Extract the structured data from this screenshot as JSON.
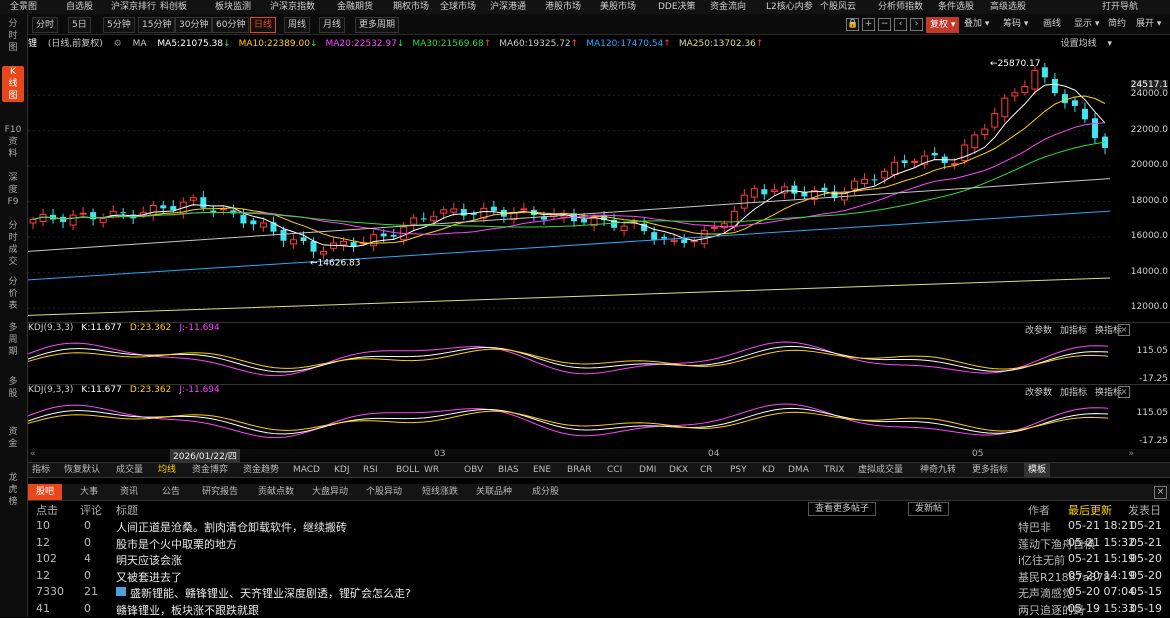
{
  "menubar": [
    "全景图",
    "自选股",
    "沪深京排行",
    "科创板",
    "板块监测",
    "沪深京指数",
    "金融期货",
    "期权市场",
    "全球市场",
    "沪深港通",
    "港股市场",
    "美股市场",
    "DDE决策",
    "资金流向",
    "L2核心内参",
    "个股风云",
    "分析师指数",
    "条件选股",
    "高级选股",
    "打开导航"
  ],
  "leftnav": [
    {
      "label": "分\n时\n图",
      "active": false
    },
    {
      "label": "K\n线\n图",
      "active": true
    },
    {
      "label": "F10\n资\n料",
      "active": false
    },
    {
      "label": "深\n度\nF9",
      "active": false
    },
    {
      "label": "分\n时\n成\n交",
      "active": false
    },
    {
      "label": "分\n价\n表",
      "active": false
    },
    {
      "label": "多\n周\n期",
      "active": false
    },
    {
      "label": "多\n股",
      "active": false
    },
    {
      "label": "资\n金",
      "active": false
    },
    {
      "label": "龙\n虎\n榜",
      "active": false
    }
  ],
  "toolbar": {
    "periods": [
      "分时",
      "5日",
      "5分钟",
      "15分钟",
      "30分钟",
      "60分钟",
      "日线",
      "周线",
      "月线",
      "更多周期"
    ],
    "selected_period": "日线",
    "right": {
      "fq": "复权",
      "overlay": "叠加",
      "chips": "筹码",
      "draw": "画线",
      "show": "显示",
      "simple": "简约",
      "expand": "展开"
    }
  },
  "ma_legend": {
    "name": "锂",
    "mode": "(日线,前复权)",
    "ma": "MA",
    "items": [
      {
        "label": "MA5:21075.38",
        "dir": "↓",
        "color": "#ffffff"
      },
      {
        "label": "MA10:22389.00",
        "dir": "↓",
        "color": "#ffd000"
      },
      {
        "label": "MA20:22532.97",
        "dir": "↓",
        "color": "#ff44ff"
      },
      {
        "label": "MA30:21569.68",
        "dir": "↑",
        "color": "#33dd33"
      },
      {
        "label": "MA60:19325.72",
        "dir": "↑",
        "color": "#c8c8c8"
      },
      {
        "label": "MA120:17470.54",
        "dir": "↑",
        "color": "#2aa8ff"
      },
      {
        "label": "MA250:13702.36",
        "dir": "↑",
        "color": "#dddd88"
      }
    ],
    "settings": "设置均线"
  },
  "price_axis": {
    "current": "24517.1",
    "ticks": [
      "24000.0",
      "22000.0",
      "20000.0",
      "18000.0",
      "16000.0",
      "14000.0",
      "12000.0"
    ]
  },
  "annotations": {
    "high": "25870.17",
    "low": "14626.83"
  },
  "kdj_panels": [
    {
      "name": "KDJ(9,3,3)",
      "k": "K:11.677",
      "d": "D:23.362",
      "j": "J:-11.694",
      "ticks": [
        "115.05",
        "-17.25"
      ],
      "actions": [
        "改参数",
        "加指标",
        "换指标"
      ]
    },
    {
      "name": "KDJ(9,3,3)",
      "k": "K:11.677",
      "d": "D:23.362",
      "j": "J:-11.694",
      "ticks": [
        "115.05",
        "-17.25"
      ],
      "actions": [
        "改参数",
        "加指标",
        "换指标"
      ]
    }
  ],
  "datebar": {
    "cursor": "2026/01/22/四",
    "months": [
      "03",
      "04",
      "05"
    ]
  },
  "indicator_tabs": [
    "指标",
    "恢复默认",
    "成交量",
    "均线",
    "资金博弈",
    "资金趋势",
    "MACD",
    "KDJ",
    "RSI",
    "BOLL",
    "WR",
    "OBV",
    "BIAS",
    "ENE",
    "BRAR",
    "CCI",
    "DMI",
    "DKX",
    "CR",
    "PSY",
    "KD",
    "DMA",
    "TRIX",
    "虚拟成交量",
    "神奇九转",
    "更多指标",
    "模板"
  ],
  "news_tabs": [
    "股吧",
    "大事",
    "资讯",
    "公告",
    "研究报告",
    "贡献点数",
    "大盘异动",
    "个股异动",
    "短线涨跌",
    "关联品种",
    "成分股"
  ],
  "news_header": {
    "clicks": "点击",
    "comments": "评论",
    "title": "标题",
    "more": "查看更多帖子",
    "post": "发新帖",
    "author": "作者",
    "updated": "最后更新",
    "posted": "发表日"
  },
  "news_rows": [
    {
      "clicks": "10",
      "comments": "0",
      "title": "人间正道是沧桑。割肉清仓卸载软件，继续搬砖",
      "author": "特巴非",
      "updated": "05-21 18:21",
      "posted": "05-21"
    },
    {
      "clicks": "12",
      "comments": "0",
      "title": "股市是个火中取栗的地方",
      "author": "莲动下渔舟自横",
      "updated": "05-21 15:32",
      "posted": "05-21"
    },
    {
      "clicks": "102",
      "comments": "4",
      "title": "明天应该会涨",
      "author": "i亿往无前",
      "updated": "05-21 15:19",
      "posted": "05-20"
    },
    {
      "clicks": "12",
      "comments": "0",
      "title": "又被套进去了",
      "author": "基民R21887a878",
      "updated": "05-20 14:19",
      "posted": "05-20"
    },
    {
      "clicks": "7330",
      "comments": "21",
      "title": "盛新锂能、赣锋锂业、天齐锂业深度剧透，锂矿会怎么走?",
      "author": "无声滴感觉",
      "updated": "05-20 07:04",
      "posted": "05-15"
    },
    {
      "clicks": "41",
      "comments": "0",
      "title": "赣锋锂业，板块涨不跟跌就跟",
      "author": "两只追逐的蚂",
      "updated": "05-19 15:33",
      "posted": "05-19"
    }
  ],
  "colors": {
    "up": "#ff3b3b",
    "down": "#3ee6f0",
    "accent": "#e8471c",
    "highlight": "#ffd000"
  }
}
